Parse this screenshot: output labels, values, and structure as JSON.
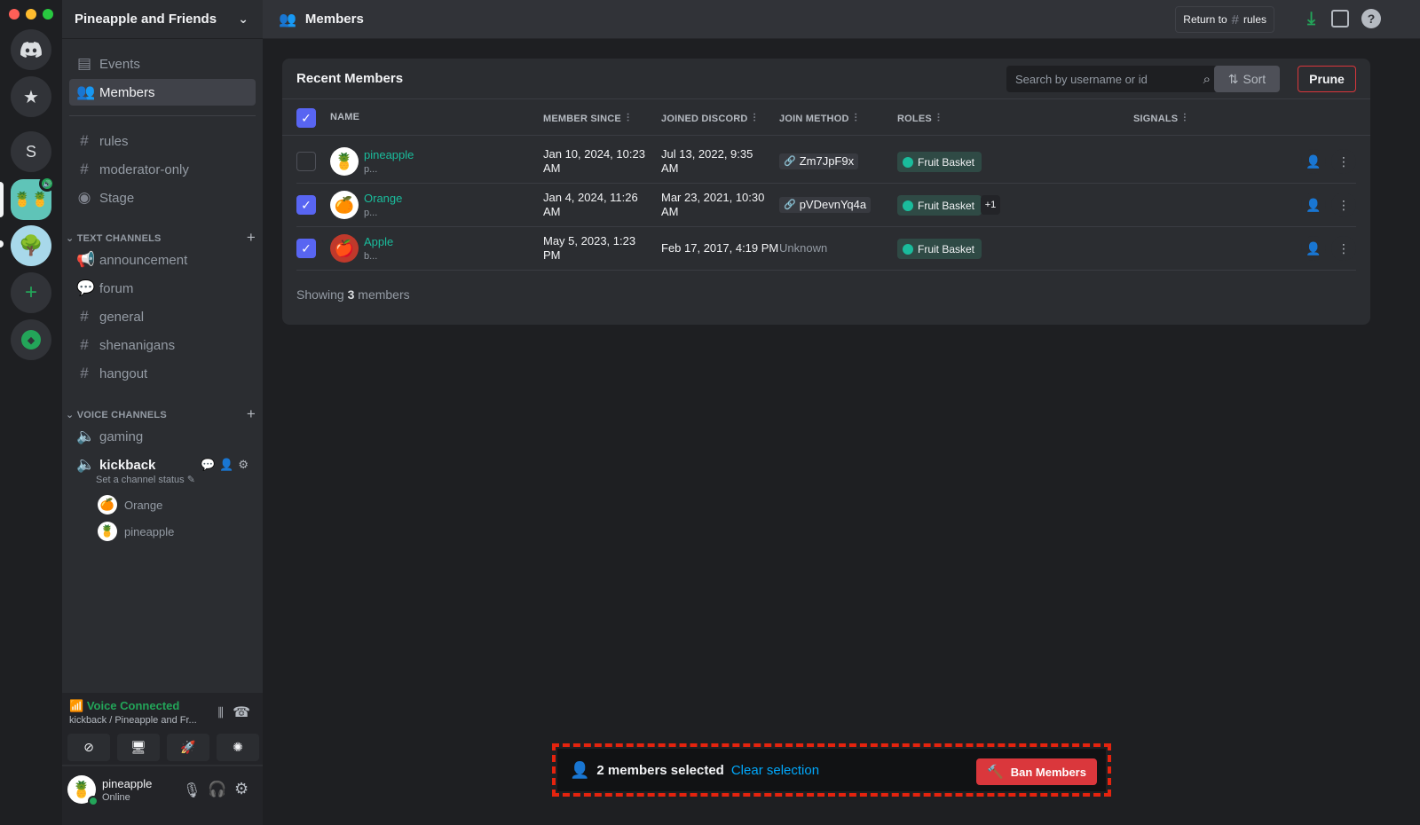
{
  "window": {
    "traffic_lights": [
      "#ff5f57",
      "#febc2e",
      "#28c840"
    ]
  },
  "rail": {
    "servers": [
      {
        "name": "Direct Messages",
        "icon": "discord-logo-icon"
      },
      {
        "name": "Favorites",
        "icon": "star-icon"
      },
      {
        "name": "S",
        "label": "S"
      },
      {
        "name": "Pineapple and Friends",
        "icon": "pineapple-pattern",
        "badge": "speaker-icon",
        "selected": true
      },
      {
        "name": "Apple tree server",
        "icon": "apple-tree"
      },
      {
        "name": "Add a Server",
        "icon": "plus-icon"
      },
      {
        "name": "Explore",
        "icon": "compass-icon"
      }
    ]
  },
  "sidebar": {
    "guild_name": "Pineapple and Friends",
    "top_items": [
      {
        "label": "Events",
        "icon": "calendar-icon"
      },
      {
        "label": "Members",
        "icon": "members-icon",
        "active": true
      }
    ],
    "channels": [
      {
        "label": "rules",
        "icon": "hash-icon"
      },
      {
        "label": "moderator-only",
        "icon": "locked-hash-icon"
      },
      {
        "label": "Stage",
        "icon": "stage-icon"
      }
    ],
    "text_category": "TEXT CHANNELS",
    "text_channels": [
      {
        "label": "announcement",
        "icon": "megaphone-icon"
      },
      {
        "label": "forum",
        "icon": "forum-icon"
      },
      {
        "label": "general",
        "icon": "hash-icon"
      },
      {
        "label": "shenanigans",
        "icon": "hash-icon"
      },
      {
        "label": "hangout",
        "icon": "hash-icon"
      }
    ],
    "voice_category": "VOICE CHANNELS",
    "voice_channels": [
      {
        "label": "gaming",
        "icon": "speaker-icon"
      },
      {
        "label": "kickback",
        "icon": "speaker-icon",
        "status": "Set a channel status",
        "members": [
          "Orange",
          "pineapple"
        ]
      }
    ]
  },
  "voice_panel": {
    "title": "Voice Connected",
    "subtitle": "kickback / Pineapple and Fr...",
    "buttons": [
      "camera-off-icon",
      "screen-share-icon",
      "activity-rocket-icon",
      "soundboard-icon"
    ]
  },
  "user_panel": {
    "name": "pineapple",
    "status": "Online"
  },
  "topbar": {
    "title": "Members",
    "return_prefix": "Return to",
    "return_channel": "rules"
  },
  "members_card": {
    "title": "Recent Members",
    "search_placeholder": "Search by username or id",
    "sort_label": "Sort",
    "prune_label": "Prune",
    "columns": [
      "NAME",
      "MEMBER SINCE",
      "JOINED DISCORD",
      "JOIN METHOD",
      "ROLES",
      "SIGNALS"
    ],
    "rows": [
      {
        "name": "pineapple",
        "sub": "p...",
        "avatar": "🍍",
        "selected": false,
        "member_since_1": "Jan 10, 2024, 10:23",
        "member_since_2": "AM",
        "joined_1": "Jul 13, 2022, 9:35",
        "joined_2": "AM",
        "join_method": "Zm7JpF9x",
        "join_is_invite": true,
        "role": "Fruit Basket",
        "extra_roles": ""
      },
      {
        "name": "Orange",
        "sub": "p...",
        "avatar": "🍊",
        "selected": true,
        "member_since_1": "Jan 4, 2024, 11:26",
        "member_since_2": "AM",
        "joined_1": "Mar 23, 2021, 10:30",
        "joined_2": "AM",
        "join_method": "pVDevnYq4a",
        "join_is_invite": true,
        "role": "Fruit Basket",
        "extra_roles": "+1"
      },
      {
        "name": "Apple",
        "sub": "b...",
        "avatar": "🍎",
        "selected": true,
        "member_since_1": "May 5, 2023, 1:23",
        "member_since_2": "PM",
        "joined_1": "Feb 17, 2017, 4:19 PM",
        "joined_2": "",
        "join_method": "Unknown",
        "join_is_invite": false,
        "role": "Fruit Basket",
        "extra_roles": ""
      }
    ],
    "showing_prefix": "Showing",
    "showing_count": "3",
    "showing_suffix": "members"
  },
  "selection_bar": {
    "count_text": "2 members selected",
    "clear_label": "Clear selection",
    "ban_label": "Ban Members"
  },
  "colors": {
    "accent": "#5865f2",
    "danger": "#da373c",
    "online": "#23a559",
    "role": "#1abc9c",
    "link": "#00a8fc"
  }
}
